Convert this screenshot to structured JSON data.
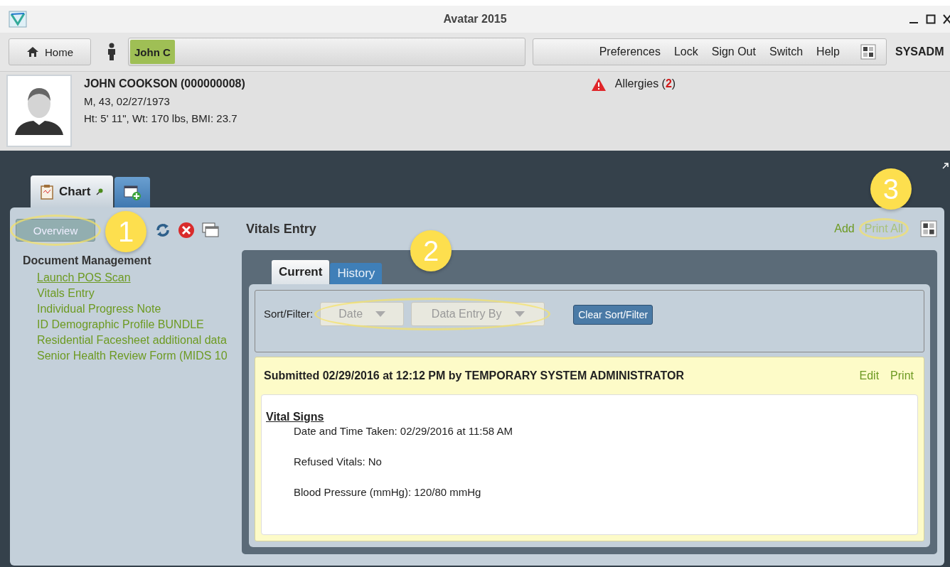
{
  "window": {
    "title": "Avatar 2015"
  },
  "toolbar": {
    "home": "Home",
    "patient_tab": {
      "label": "John C",
      "selected": true
    },
    "menu": [
      "Preferences",
      "Lock",
      "Sign Out",
      "Switch",
      "Help"
    ],
    "user": "SYSADM"
  },
  "patient": {
    "name": "JOHN COOKSON (000000008)",
    "demographics": "M, 43, 02/27/1973",
    "measurements": "Ht: 5' 11\", Wt: 170 lbs, BMI: 23.7",
    "allergies": "Allergies (**2**)"
  },
  "tabs": [
    {
      "kind": "chart",
      "label": "Chart",
      "selected": true
    },
    {
      "kind": "add",
      "selected": false
    }
  ],
  "sidebar": {
    "overview_button": {
      "label": "Overview",
      "highlighted": true,
      "callout": "1"
    },
    "section": "Document Management",
    "items": [
      {
        "label": "Launch POS Scan",
        "selected": true
      },
      {
        "label": "Vitals Entry",
        "selected": false
      },
      {
        "label": "Individual Progress Note",
        "selected": false
      },
      {
        "label": "ID Demographic Profile BUNDLE",
        "selected": false
      },
      {
        "label": "Residential Facesheet additional data",
        "selected": false
      },
      {
        "label": "Senior Health Review Form (MIDS 10",
        "selected": false
      }
    ]
  },
  "main": {
    "title": "Vitals Entry",
    "actions": [
      {
        "label": "Add",
        "highlighted": false,
        "disabled": false
      },
      {
        "label": "Print All",
        "highlighted": true,
        "disabled": true,
        "callout": "3"
      }
    ],
    "tabs": [
      {
        "label": "Current",
        "selected": true
      },
      {
        "label": "History",
        "selected": false
      }
    ],
    "sort_filter": {
      "label": "Sort/Filter:",
      "highlighted": true,
      "callout": "2",
      "dropdowns": [
        "Date",
        "Data Entry By"
      ],
      "clear_button": "Clear Sort/Filter"
    },
    "entry": {
      "header": "Submitted 02/29/2016 at 12:12 PM by TEMPORARY SYSTEM ADMINISTRATOR",
      "actions": [
        "Edit",
        "Print"
      ],
      "section_title": "Vital Signs",
      "fields": [
        "Date and Time Taken: 02/29/2016 at 11:58 AM",
        "Refused Vitals: No",
        "Blood Pressure (mmHg): 120/80 mmHg"
      ]
    }
  }
}
